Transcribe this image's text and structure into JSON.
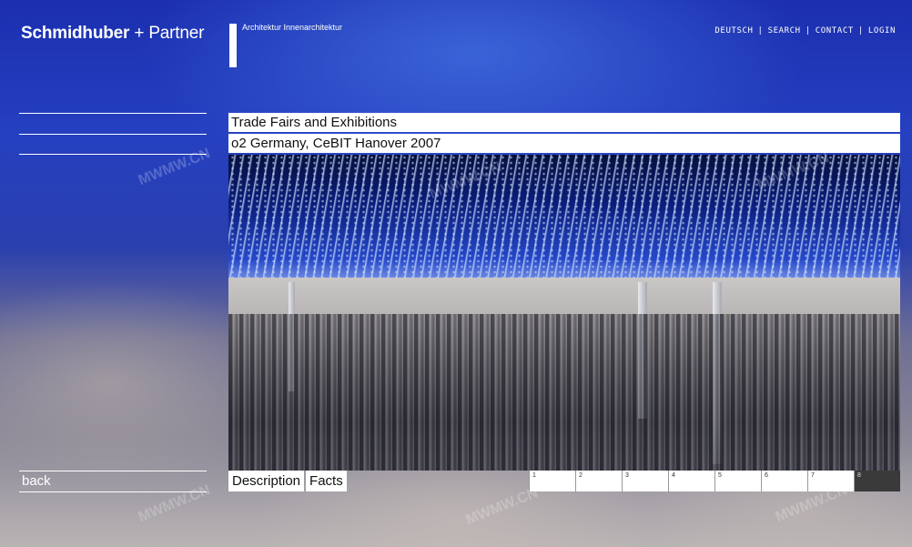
{
  "brand": {
    "name_bold": "Schmidhuber",
    "plus": "+",
    "name_regular": "Partner",
    "tagline": "Architektur  Innenarchitektur"
  },
  "topnav": {
    "items": [
      "DEUTSCH",
      "SEARCH",
      "CONTACT",
      "LOGIN"
    ],
    "separator": "|"
  },
  "sidebar": {
    "back_label": "back"
  },
  "main": {
    "category": "Trade Fairs and Exhibitions",
    "project": "o2 Germany, CeBIT Hanover 2007",
    "photo_alt": "o2 CeBIT hall",
    "tabs": [
      "Description",
      "Facts"
    ],
    "pages": [
      "1",
      "2",
      "3",
      "4",
      "5",
      "6",
      "7",
      "8"
    ],
    "active_page": "8"
  },
  "watermark": "MWMW.CN"
}
